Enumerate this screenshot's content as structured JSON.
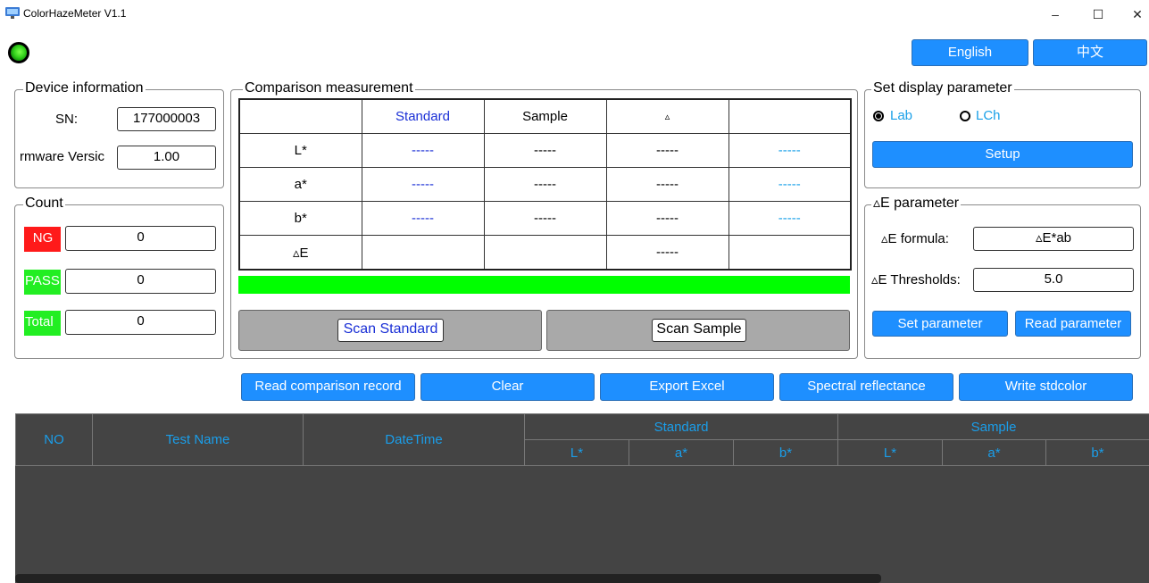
{
  "window": {
    "title": "ColorHazeMeter V1.1",
    "minimize": "–",
    "maximize": "☐",
    "close": "✕"
  },
  "language": {
    "english": "English",
    "chinese": "中文"
  },
  "device_info": {
    "title": "Device information",
    "sn_label": "SN:",
    "sn_value": "177000003",
    "firmware_label": "rmware Versic",
    "firmware_value": "1.00"
  },
  "count": {
    "title": "Count",
    "ng_label": "NG",
    "ng_value": "0",
    "pass_label": "PASS",
    "pass_value": "0",
    "total_label": "Total",
    "total_value": "0"
  },
  "comparison": {
    "title": "Comparison measurement",
    "headers": [
      "",
      "Standard",
      "Sample",
      "▵",
      ""
    ],
    "rows": [
      {
        "label": "L*",
        "standard": "-----",
        "sample": "-----",
        "delta": "-----",
        "extra": "-----"
      },
      {
        "label": "a*",
        "standard": "-----",
        "sample": "-----",
        "delta": "-----",
        "extra": "-----"
      },
      {
        "label": "b*",
        "standard": "-----",
        "sample": "-----",
        "delta": "-----",
        "extra": "-----"
      },
      {
        "label": "▵E",
        "standard": "",
        "sample": "",
        "delta": "-----",
        "extra": ""
      }
    ],
    "status_color": "#00ff00",
    "scan_standard": "Scan Standard",
    "scan_sample": "Scan Sample"
  },
  "display_param": {
    "title": "Set display parameter",
    "option_lab": "Lab",
    "option_lch": "LCh",
    "selected": "Lab",
    "setup": "Setup"
  },
  "de_param": {
    "title": "▵E parameter",
    "formula_label": "▵E formula:",
    "formula_value": "▵E*ab",
    "thresholds_label": "▵E Thresholds:",
    "thresholds_value": "5.0",
    "set_button": "Set parameter",
    "read_button": "Read parameter"
  },
  "actions": {
    "read_record": "Read comparison record",
    "clear": "Clear",
    "export_excel": "Export Excel",
    "spectral": "Spectral reflectance",
    "write_std": "Write stdcolor"
  },
  "grid": {
    "col_no": "NO",
    "col_name": "Test Name",
    "col_datetime": "DateTime",
    "group_standard": "Standard",
    "group_sample": "Sample",
    "sub_l": "L*",
    "sub_a": "a*",
    "sub_b": "b*"
  },
  "colors": {
    "accent_blue": "#1e8fff",
    "ng_red": "#ff1a1a",
    "pass_green": "#22ee22",
    "grid_bg": "#444444",
    "grid_text": "#1a9eea"
  }
}
